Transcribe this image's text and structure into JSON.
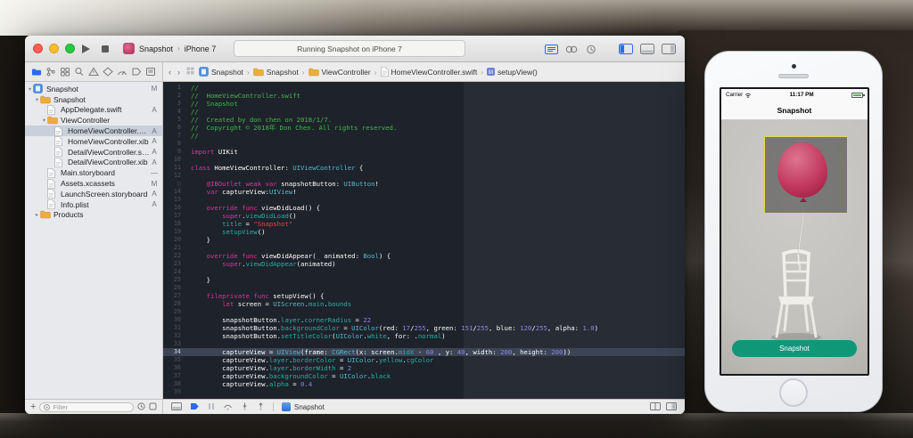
{
  "titlebar": {
    "scheme_name": "Snapshot",
    "device_name": "iPhone 7",
    "status_text": "Running Snapshot on iPhone 7"
  },
  "jump_bar": {
    "items": [
      {
        "label": "Snapshot",
        "icon": "project"
      },
      {
        "label": "Snapshot",
        "icon": "folder"
      },
      {
        "label": "ViewController",
        "icon": "folder"
      },
      {
        "label": "HomeViewController.swift",
        "icon": "swift"
      },
      {
        "label": "setupView()",
        "icon": "method"
      }
    ]
  },
  "navigator": {
    "filter_placeholder": "Filter",
    "files": [
      {
        "label": "Snapshot",
        "type": "project",
        "status": "M",
        "depth": 0,
        "expand": "down"
      },
      {
        "label": "Snapshot",
        "type": "folder",
        "status": "",
        "depth": 1,
        "expand": "down"
      },
      {
        "label": "AppDelegate.swift",
        "type": "swift",
        "status": "A",
        "depth": 2
      },
      {
        "label": "ViewController",
        "type": "folder",
        "status": "",
        "depth": 2,
        "expand": "down"
      },
      {
        "label": "HomeViewController.swift",
        "type": "swift",
        "status": "A",
        "depth": 3,
        "selected": true
      },
      {
        "label": "HomeViewController.xib",
        "type": "xib",
        "status": "A",
        "depth": 3
      },
      {
        "label": "DetailViewController.swift",
        "type": "swift",
        "status": "A",
        "depth": 3
      },
      {
        "label": "DetailViewController.xib",
        "type": "xib",
        "status": "A",
        "depth": 3
      },
      {
        "label": "Main.storyboard",
        "type": "storyboard",
        "status": "—",
        "depth": 2
      },
      {
        "label": "Assets.xcassets",
        "type": "assets",
        "status": "M",
        "depth": 2
      },
      {
        "label": "LaunchScreen.storyboard",
        "type": "storyboard",
        "status": "A",
        "depth": 2
      },
      {
        "label": "Info.plist",
        "type": "plist",
        "status": "A",
        "depth": 2
      },
      {
        "label": "Products",
        "type": "folder",
        "status": "",
        "depth": 1,
        "expand": "right"
      }
    ]
  },
  "editor": {
    "highlight_line": 34,
    "outlet_line": 13,
    "lines": [
      [
        [
          "c",
          "//"
        ]
      ],
      [
        [
          "c",
          "//  HomeViewController.swift"
        ]
      ],
      [
        [
          "c",
          "//  Snapshot"
        ]
      ],
      [
        [
          "c",
          "//"
        ]
      ],
      [
        [
          "c",
          "//  Created by don chen on 2018/1/7."
        ]
      ],
      [
        [
          "c",
          "//  Copyright © 2018年 Don Chen. All rights reserved."
        ]
      ],
      [
        [
          "c",
          "//"
        ]
      ],
      [],
      [
        [
          "k",
          "import"
        ],
        [
          "p",
          " UIKit"
        ]
      ],
      [],
      [
        [
          "k",
          "class"
        ],
        [
          "p",
          " HomeViewController: "
        ],
        [
          "t",
          "UIViewController"
        ],
        [
          "p",
          " {"
        ]
      ],
      [],
      [
        [
          "p",
          "    "
        ],
        [
          "k",
          "@IBOutlet"
        ],
        [
          "p",
          " "
        ],
        [
          "k",
          "weak"
        ],
        [
          "p",
          " "
        ],
        [
          "k",
          "var"
        ],
        [
          "p",
          " snapshotButton: "
        ],
        [
          "t",
          "UIButton"
        ],
        [
          "p",
          "!"
        ]
      ],
      [
        [
          "p",
          "    "
        ],
        [
          "k",
          "var"
        ],
        [
          "p",
          " captureView:"
        ],
        [
          "t",
          "UIView"
        ],
        [
          "p",
          "!"
        ]
      ],
      [],
      [
        [
          "p",
          "    "
        ],
        [
          "k",
          "override"
        ],
        [
          "p",
          " "
        ],
        [
          "k",
          "func"
        ],
        [
          "p",
          " viewDidLoad() {"
        ]
      ],
      [
        [
          "p",
          "        "
        ],
        [
          "k",
          "super"
        ],
        [
          "p",
          "."
        ],
        [
          "m",
          "viewDidLoad"
        ],
        [
          "p",
          "()"
        ]
      ],
      [
        [
          "p",
          "        "
        ],
        [
          "m",
          "title"
        ],
        [
          "p",
          " = "
        ],
        [
          "s",
          "\"Snapshot\""
        ]
      ],
      [
        [
          "p",
          "        "
        ],
        [
          "m",
          "setupView"
        ],
        [
          "p",
          "()"
        ]
      ],
      [
        [
          "p",
          "    }"
        ]
      ],
      [],
      [
        [
          "p",
          "    "
        ],
        [
          "k",
          "override"
        ],
        [
          "p",
          " "
        ],
        [
          "k",
          "func"
        ],
        [
          "p",
          " viewDidAppear("
        ],
        [
          "k",
          "_"
        ],
        [
          "p",
          " animated: "
        ],
        [
          "t",
          "Bool"
        ],
        [
          "p",
          ") {"
        ]
      ],
      [
        [
          "p",
          "        "
        ],
        [
          "k",
          "super"
        ],
        [
          "p",
          "."
        ],
        [
          "m",
          "viewDidAppear"
        ],
        [
          "p",
          "(animated)"
        ]
      ],
      [],
      [
        [
          "p",
          "    }"
        ]
      ],
      [],
      [
        [
          "p",
          "    "
        ],
        [
          "k",
          "fileprivate"
        ],
        [
          "p",
          " "
        ],
        [
          "k",
          "func"
        ],
        [
          "p",
          " setupView() {"
        ]
      ],
      [
        [
          "p",
          "        "
        ],
        [
          "k",
          "let"
        ],
        [
          "p",
          " screen = "
        ],
        [
          "t",
          "UIScreen"
        ],
        [
          "p",
          "."
        ],
        [
          "m",
          "main"
        ],
        [
          "p",
          "."
        ],
        [
          "m",
          "bounds"
        ]
      ],
      [],
      [
        [
          "p",
          "        snapshotButton."
        ],
        [
          "m",
          "layer"
        ],
        [
          "p",
          "."
        ],
        [
          "m",
          "cornerRadius"
        ],
        [
          "p",
          " = "
        ],
        [
          "n",
          "22"
        ]
      ],
      [
        [
          "p",
          "        snapshotButton."
        ],
        [
          "m",
          "backgroundColor"
        ],
        [
          "p",
          " = "
        ],
        [
          "t",
          "UIColor"
        ],
        [
          "p",
          "(red: "
        ],
        [
          "n",
          "17"
        ],
        [
          "p",
          "/"
        ],
        [
          "n",
          "255"
        ],
        [
          "p",
          ", green: "
        ],
        [
          "n",
          "151"
        ],
        [
          "p",
          "/"
        ],
        [
          "n",
          "255"
        ],
        [
          "p",
          ", blue: "
        ],
        [
          "n",
          "120"
        ],
        [
          "p",
          "/"
        ],
        [
          "n",
          "255"
        ],
        [
          "p",
          ", alpha: "
        ],
        [
          "n",
          "1.0"
        ],
        [
          "p",
          ")"
        ]
      ],
      [
        [
          "p",
          "        snapshotButton."
        ],
        [
          "m",
          "setTitleColor"
        ],
        [
          "p",
          "("
        ],
        [
          "t",
          "UIColor"
        ],
        [
          "p",
          "."
        ],
        [
          "m",
          "white"
        ],
        [
          "p",
          ", for: ."
        ],
        [
          "m",
          "normal"
        ],
        [
          "p",
          ")"
        ]
      ],
      [],
      [
        [
          "p",
          "        captureView = "
        ],
        [
          "t",
          "UIView"
        ],
        [
          "p",
          "(frame: "
        ],
        [
          "t",
          "CGRect"
        ],
        [
          "p",
          "(x: screen."
        ],
        [
          "m",
          "midX"
        ],
        [
          "p",
          " - "
        ],
        [
          "n",
          "60"
        ],
        [
          "p",
          " , y: "
        ],
        [
          "n",
          "40"
        ],
        [
          "p",
          ", width: "
        ],
        [
          "n",
          "200"
        ],
        [
          "p",
          ", height: "
        ],
        [
          "n",
          "200"
        ],
        [
          "p",
          "))"
        ]
      ],
      [
        [
          "p",
          "        captureView."
        ],
        [
          "m",
          "layer"
        ],
        [
          "p",
          "."
        ],
        [
          "m",
          "borderColor"
        ],
        [
          "p",
          " = "
        ],
        [
          "t",
          "UIColor"
        ],
        [
          "p",
          "."
        ],
        [
          "m",
          "yellow"
        ],
        [
          "p",
          "."
        ],
        [
          "m",
          "cgColor"
        ]
      ],
      [
        [
          "p",
          "        captureView."
        ],
        [
          "m",
          "layer"
        ],
        [
          "p",
          "."
        ],
        [
          "m",
          "borderWidth"
        ],
        [
          "p",
          " = "
        ],
        [
          "n",
          "2"
        ]
      ],
      [
        [
          "p",
          "        captureView."
        ],
        [
          "m",
          "backgroundColor"
        ],
        [
          "p",
          " = "
        ],
        [
          "t",
          "UIColor"
        ],
        [
          "p",
          "."
        ],
        [
          "m",
          "black"
        ]
      ],
      [
        [
          "p",
          "        captureView."
        ],
        [
          "m",
          "alpha"
        ],
        [
          "p",
          " = "
        ],
        [
          "n",
          "0.4"
        ]
      ],
      []
    ]
  },
  "debug_bar": {
    "crumb": "Snapshot"
  },
  "simulator": {
    "status_bar": {
      "carrier": "Carrier",
      "time": "11:17 PM"
    },
    "nav_title": "Snapshot",
    "button": {
      "label": "Snapshot",
      "color": "#0F9778"
    }
  },
  "colors": {
    "accent": "#2A6BEF",
    "code": {
      "plain": "#FFFFFF",
      "comment": "#3EBB4C",
      "keyword": "#DB359E",
      "type": "#53B9CF",
      "member": "#23B2A3",
      "string": "#EF4148",
      "number": "#8D85EA",
      "gutter": "#4E5765",
      "bg": "#1E222A",
      "bg2": "#272C35",
      "hl": "#3C4455"
    }
  }
}
